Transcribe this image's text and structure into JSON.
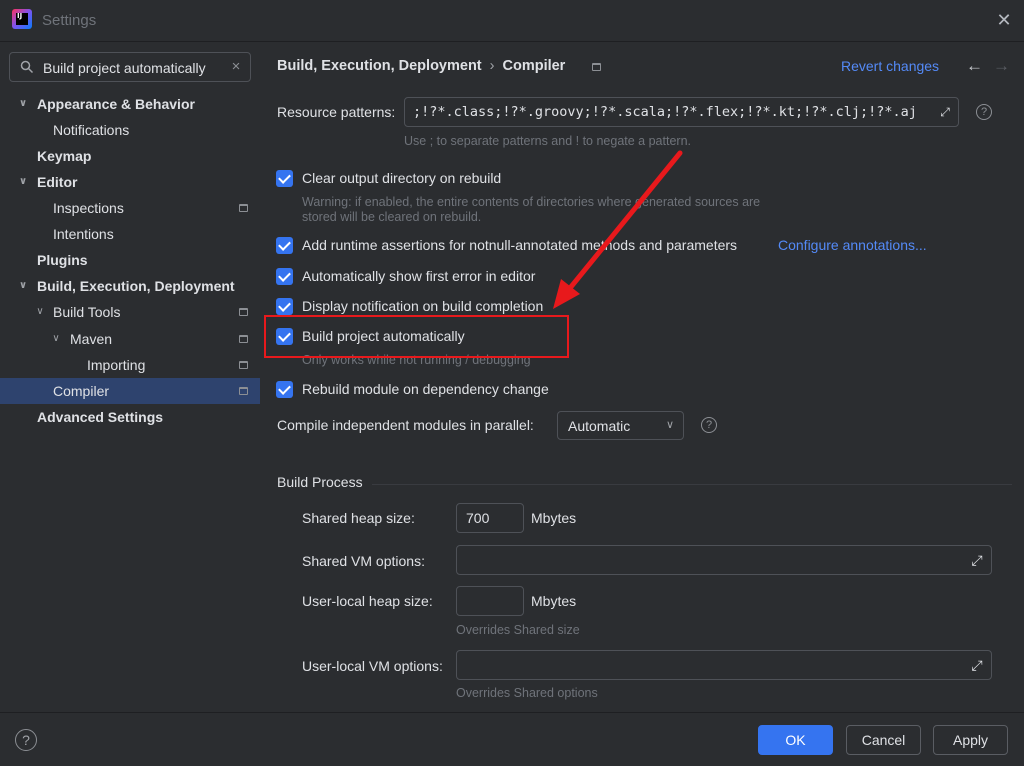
{
  "window": {
    "title": "Settings",
    "logo_text": "IJ"
  },
  "sidebar": {
    "search": {
      "value": "Build project automatically"
    },
    "items": [
      {
        "label": "Appearance & Behavior",
        "bold": true,
        "expanded": true
      },
      {
        "label": "Notifications"
      },
      {
        "label": "Keymap",
        "bold": true
      },
      {
        "label": "Editor",
        "bold": true,
        "expanded": true
      },
      {
        "label": "Inspections"
      },
      {
        "label": "Intentions"
      },
      {
        "label": "Plugins",
        "bold": true
      },
      {
        "label": "Build, Execution, Deployment",
        "bold": true,
        "expanded": true
      },
      {
        "label": "Build Tools",
        "expanded": true
      },
      {
        "label": "Maven",
        "expanded": true
      },
      {
        "label": "Importing"
      },
      {
        "label": "Compiler",
        "selected": true
      },
      {
        "label": "Advanced Settings",
        "bold": true
      }
    ]
  },
  "header": {
    "breadcrumb_parent": "Build, Execution, Deployment",
    "breadcrumb_separator": "›",
    "breadcrumb_current": "Compiler",
    "revert_label": "Revert changes"
  },
  "compiler": {
    "resource_patterns_label": "Resource patterns:",
    "resource_patterns_value": ";!?*.class;!?*.groovy;!?*.scala;!?*.flex;!?*.kt;!?*.clj;!?*.aj",
    "resource_hint": "Use ; to separate patterns and ! to negate a pattern.",
    "clear_output_label": "Clear output directory on rebuild",
    "clear_output_hint_1": "Warning: if enabled, the entire contents of directories where generated sources are",
    "clear_output_hint_2": "stored will be cleared on rebuild.",
    "runtime_assertions_label": "Add runtime assertions for notnull-annotated methods and parameters",
    "configure_annotations_label": "Configure annotations...",
    "show_first_error_label": "Automatically show first error in editor",
    "display_notification_label": "Display notification on build completion",
    "build_automatically_label": "Build project automatically",
    "build_automatically_hint": "Only works while not running / debugging",
    "rebuild_module_label": "Rebuild module on dependency change",
    "compile_parallel_label": "Compile independent modules in parallel:",
    "compile_parallel_value": "Automatic"
  },
  "build_process": {
    "title": "Build Process",
    "shared_heap_label": "Shared heap size:",
    "shared_heap_value": "700",
    "mbytes_label": "Mbytes",
    "shared_vm_label": "Shared VM options:",
    "user_heap_label": "User-local heap size:",
    "user_heap_mbytes_label": "Mbytes",
    "user_heap_hint": "Overrides Shared size",
    "user_vm_label": "User-local VM options:",
    "user_vm_hint": "Overrides Shared options"
  },
  "footer": {
    "ok_label": "OK",
    "cancel_label": "Cancel",
    "apply_label": "Apply"
  },
  "colors": {
    "accent": "#3574f0",
    "link": "#548af7",
    "annotation_red": "#e8191c",
    "selection": "#2e436e"
  }
}
